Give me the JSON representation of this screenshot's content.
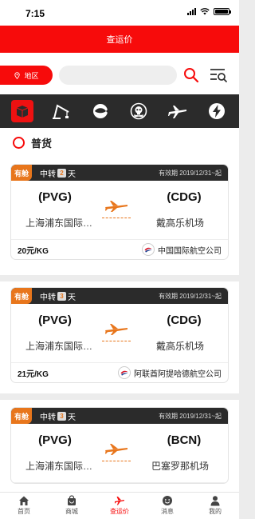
{
  "status": {
    "time": "7:15"
  },
  "header": {
    "title": "查运价"
  },
  "search": {
    "region_label": "地区",
    "placeholder": ""
  },
  "categories": [
    {
      "icon": "cargo-box-icon",
      "active": true
    },
    {
      "icon": "crane-icon",
      "active": false
    },
    {
      "icon": "fresh-produce-icon",
      "active": false
    },
    {
      "icon": "hazardous-skull-icon",
      "active": false
    },
    {
      "icon": "airplane-icon",
      "active": false
    },
    {
      "icon": "lightning-icon",
      "active": false
    }
  ],
  "section": {
    "title": "普货"
  },
  "cards": [
    {
      "cabin": "有舱",
      "transfer_prefix": "中转",
      "transfer_count": "2",
      "transfer_suffix": "天",
      "validity": "有效期 2019/12/31~起",
      "origin_code": "(PVG)",
      "origin_city": "上海浦东国际…",
      "dest_code": "(CDG)",
      "dest_city": "戴高乐机场",
      "price": "20元/KG",
      "airline": "中国国际航空公司",
      "airline_logo": "china-eastern-logo-icon"
    },
    {
      "cabin": "有舱",
      "transfer_prefix": "中转",
      "transfer_count": "3",
      "transfer_suffix": "天",
      "validity": "有效期 2019/12/31~起",
      "origin_code": "(PVG)",
      "origin_city": "上海浦东国际…",
      "dest_code": "(CDG)",
      "dest_city": "戴高乐机场",
      "price": "21元/KG",
      "airline": "阿联酋阿提哈德航空公司",
      "airline_logo": "china-eastern-logo-icon"
    },
    {
      "cabin": "有舱",
      "transfer_prefix": "中转",
      "transfer_count": "3",
      "transfer_suffix": "天",
      "validity": "有效期 2019/12/31~起",
      "origin_code": "(PVG)",
      "origin_city": "上海浦东国际…",
      "dest_code": "(BCN)",
      "dest_city": "巴塞罗那机场",
      "price": "",
      "airline": "",
      "airline_logo": ""
    }
  ],
  "tabs": [
    {
      "label": "首页",
      "icon": "home-icon",
      "active": false
    },
    {
      "label": "商城",
      "icon": "shop-bag-icon",
      "active": false
    },
    {
      "label": "查运价",
      "icon": "freight-query-icon",
      "active": true
    },
    {
      "label": "消息",
      "icon": "message-icon",
      "active": false
    },
    {
      "label": "我的",
      "icon": "user-icon",
      "active": false
    }
  ],
  "colors": {
    "primary_red": "#f70b0b",
    "dark_bar": "#2b2b2b",
    "accent_orange": "#e8761c"
  }
}
